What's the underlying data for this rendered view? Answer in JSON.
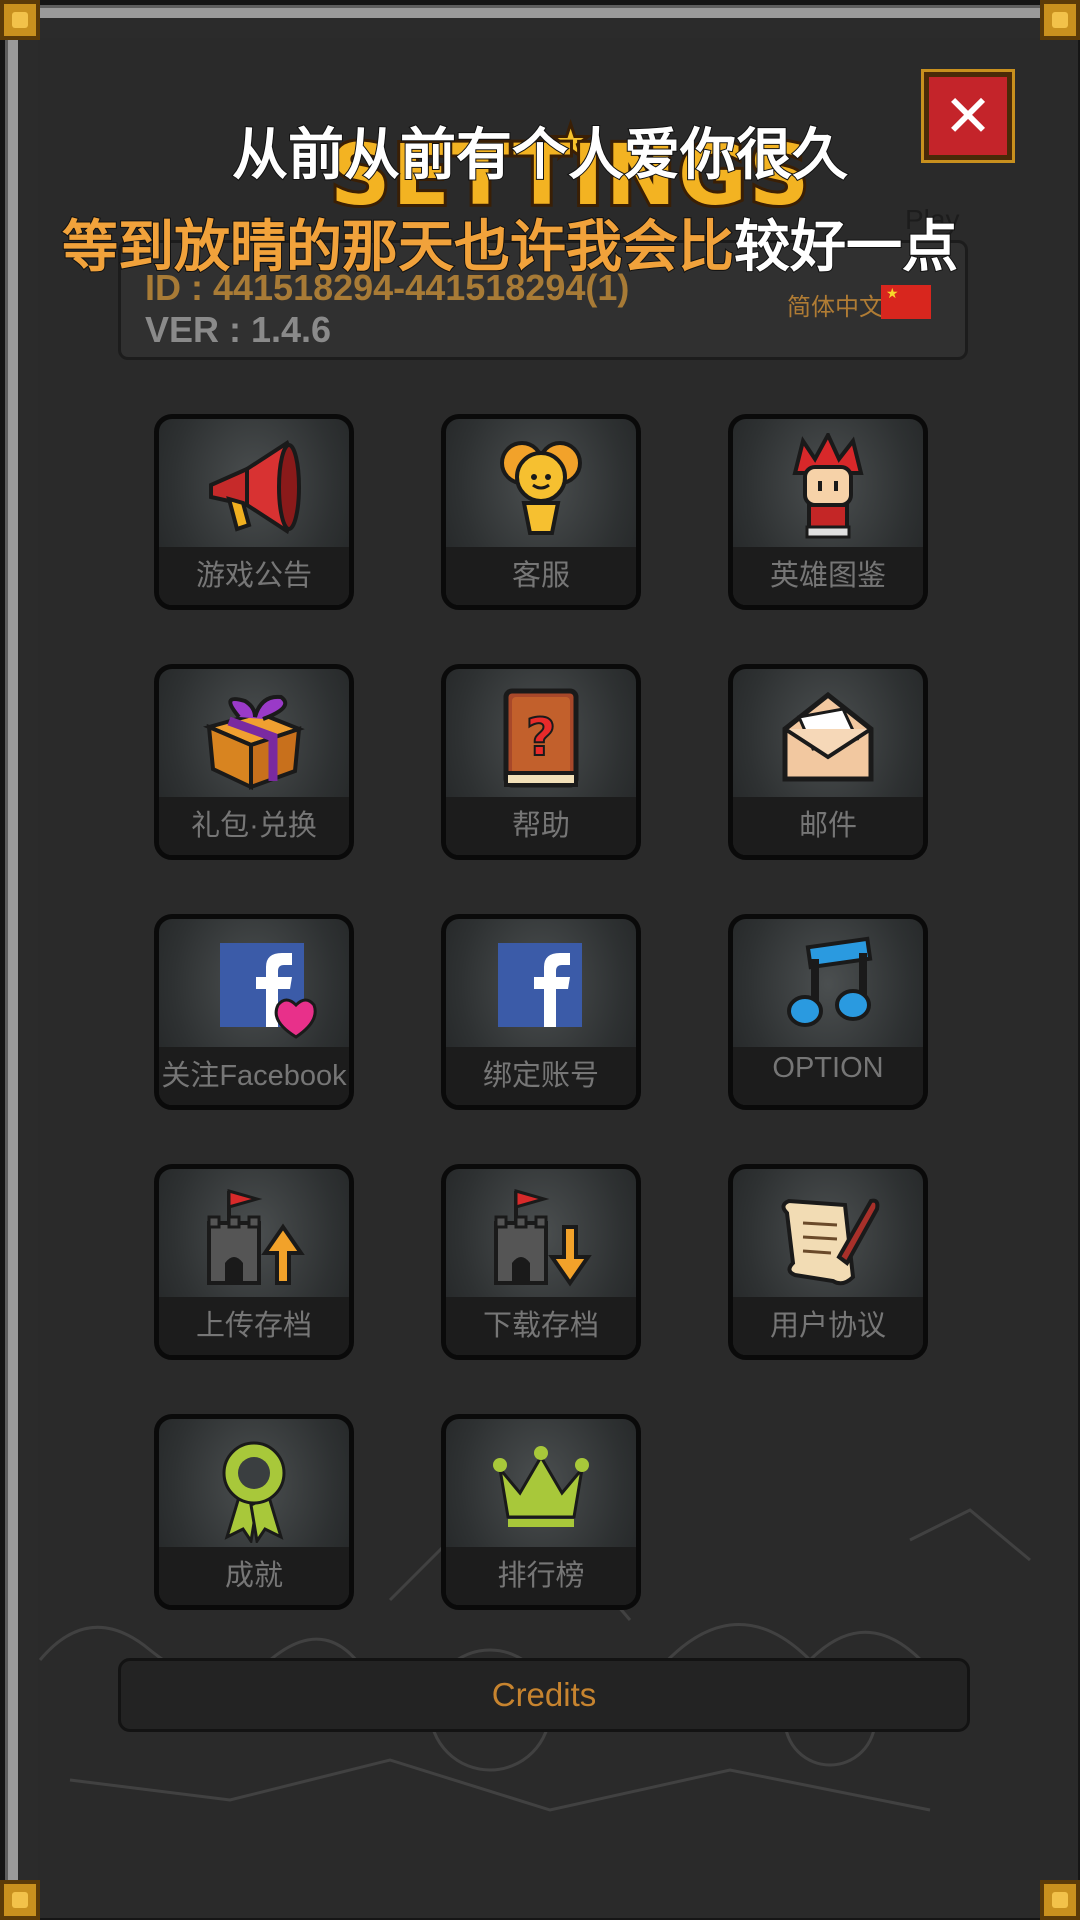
{
  "title": "SETTINGS",
  "close_label": "✕",
  "overlay": {
    "line1": "从前从前有个人爱你很久",
    "line2_a": "等到放晴的那天也许我会比",
    "line2_b": "较好一点",
    "line1_color": "#ffffff",
    "line2_a_color": "#f1a23b",
    "line2_b_color": "#ffffff"
  },
  "play_text": "Play",
  "info": {
    "id": "ID : 441518294-441518294(1)",
    "version": "VER : 1.4.6",
    "language": "简体中文"
  },
  "buttons": [
    {
      "label": "游戏公告",
      "icon": "megaphone-icon"
    },
    {
      "label": "客服",
      "icon": "fairy-icon"
    },
    {
      "label": "英雄图鉴",
      "icon": "hero-icon"
    },
    {
      "label": "礼包·兑换",
      "icon": "gift-box-icon"
    },
    {
      "label": "帮助",
      "icon": "help-book-icon"
    },
    {
      "label": "邮件",
      "icon": "envelope-icon"
    },
    {
      "label": "关注Facebook",
      "icon": "facebook-heart-icon"
    },
    {
      "label": "绑定账号",
      "icon": "facebook-icon"
    },
    {
      "label": "OPTION",
      "icon": "music-notes-icon"
    },
    {
      "label": "上传存档",
      "icon": "castle-upload-icon"
    },
    {
      "label": "下载存档",
      "icon": "castle-download-icon"
    },
    {
      "label": "用户协议",
      "icon": "scroll-quill-icon"
    },
    {
      "label": "成就",
      "icon": "ribbon-medal-icon"
    },
    {
      "label": "排行榜",
      "icon": "crown-icon"
    }
  ],
  "credits_label": "Credits"
}
